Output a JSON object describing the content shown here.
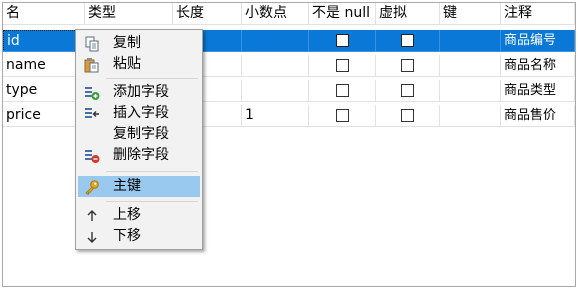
{
  "table": {
    "headers": [
      "名",
      "类型",
      "长度",
      "小数点",
      "不是 null",
      "虚拟",
      "键",
      "注释"
    ],
    "rows": [
      {
        "name": "id",
        "type": "",
        "length": "",
        "decimals": "",
        "comment": "商品编号"
      },
      {
        "name": "name",
        "type": "",
        "length": "",
        "decimals": "",
        "comment": "商品名称"
      },
      {
        "name": "type",
        "type": "",
        "length": "",
        "decimals": "",
        "comment": "商品类型"
      },
      {
        "name": "price",
        "type": "",
        "length": "",
        "decimals": "1",
        "comment": "商品售价"
      }
    ],
    "selected_row": 0
  },
  "context_menu": {
    "items": [
      {
        "label": "复制",
        "icon": "copy-icon"
      },
      {
        "label": "粘贴",
        "icon": "paste-icon"
      },
      {
        "label": "添加字段",
        "icon": "add-field-icon"
      },
      {
        "label": "插入字段",
        "icon": "insert-field-icon"
      },
      {
        "label": "复制字段",
        "icon": ""
      },
      {
        "label": "删除字段",
        "icon": "delete-field-icon"
      },
      {
        "label": "主键",
        "icon": "key-icon",
        "highlighted": true
      },
      {
        "label": "上移",
        "icon": "arrow-up-icon"
      },
      {
        "label": "下移",
        "icon": "arrow-down-icon"
      }
    ]
  },
  "colors": {
    "selection": "#0a78d7",
    "menu_highlight": "#99c9ef",
    "menu_background": "#f2f2f2"
  }
}
